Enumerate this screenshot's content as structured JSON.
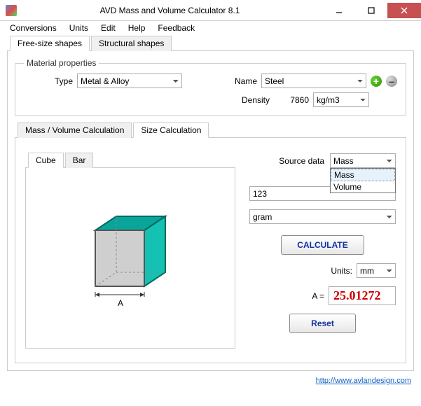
{
  "window": {
    "title": "AVD Mass and Volume Calculator 8.1"
  },
  "menu": {
    "items": [
      "Conversions",
      "Units",
      "Edit",
      "Help",
      "Feedback"
    ]
  },
  "topTabs": {
    "items": [
      "Free-size shapes",
      "Structural shapes"
    ],
    "active": 0
  },
  "material": {
    "legend": "Material properties",
    "typeLabel": "Type",
    "typeValue": "Metal & Alloy",
    "nameLabel": "Name",
    "nameValue": "Steel",
    "densityLabel": "Density",
    "densityValue": "7860",
    "densityUnit": "kg/m3"
  },
  "calcTabs": {
    "items": [
      "Mass / Volume  Calculation",
      "Size  Calculation"
    ],
    "active": 1
  },
  "shapeTabs": {
    "items": [
      "Cube",
      "Bar"
    ],
    "active": 0
  },
  "shape": {
    "dimLabel": "A"
  },
  "source": {
    "label": "Source data",
    "selected": "Mass",
    "options": [
      "Mass",
      "Volume"
    ],
    "inputValue": "123",
    "unit": "gram"
  },
  "buttons": {
    "calculate": "CALCULATE",
    "reset": "Reset"
  },
  "result": {
    "unitsLabel": "Units:",
    "unitsValue": "mm",
    "varLabel": "A =",
    "value": "25.01272"
  },
  "footer": {
    "link": "http://www.avlandesign.com"
  }
}
